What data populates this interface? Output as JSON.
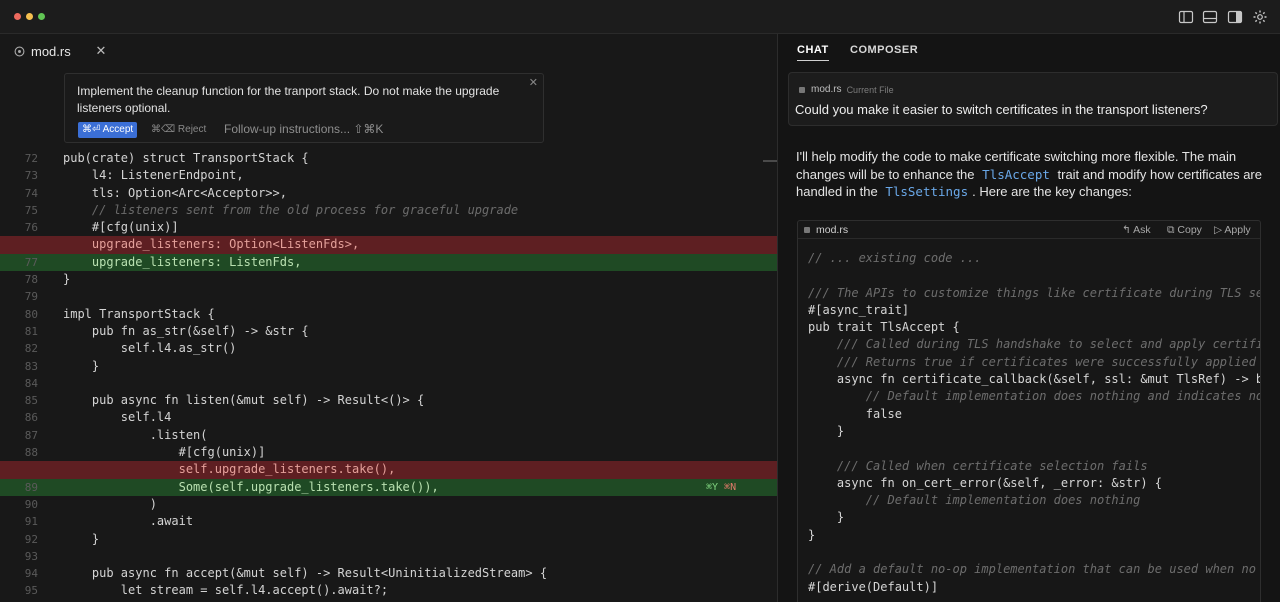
{
  "window": {
    "colors": {
      "close": "#ed6a5e",
      "minimize": "#f5bf4f",
      "maximize": "#61c554",
      "accept": "#3b6fd6"
    },
    "toolbar_icons": [
      "sidebar-left-icon",
      "panel-bottom-icon",
      "sidebar-right-icon",
      "gear-icon"
    ]
  },
  "editor": {
    "tab": {
      "label": "mod.rs",
      "close": "✕"
    },
    "prompt": {
      "text": "Implement the cleanup function for the tranport stack. Do not make the upgrade listeners optional.",
      "close": "✕",
      "accept": "⌘⏎ Accept",
      "reject": "⌘⌫ Reject",
      "followup": "Follow-up instructions... ⇧⌘K"
    },
    "lines": [
      {
        "n": "72",
        "t": "pub(crate) struct TransportStack {",
        "s": ""
      },
      {
        "n": "73",
        "t": "    l4: ListenerEndpoint,",
        "s": ""
      },
      {
        "n": "74",
        "t": "    tls: Option<Arc<Acceptor>>,",
        "s": ""
      },
      {
        "n": "75",
        "t": "    // listeners sent from the old process for graceful upgrade",
        "s": "c"
      },
      {
        "n": "76",
        "t": "    #[cfg(unix)]",
        "s": ""
      },
      {
        "n": "",
        "t": "    upgrade_listeners: Option<ListenFds>,",
        "s": "del"
      },
      {
        "n": "77",
        "t": "    upgrade_listeners: ListenFds,",
        "s": "add"
      },
      {
        "n": "78",
        "t": "}",
        "s": ""
      },
      {
        "n": "79",
        "t": "",
        "s": ""
      },
      {
        "n": "80",
        "t": "impl TransportStack {",
        "s": ""
      },
      {
        "n": "81",
        "t": "    pub fn as_str(&self) -> &str {",
        "s": ""
      },
      {
        "n": "82",
        "t": "        self.l4.as_str()",
        "s": ""
      },
      {
        "n": "83",
        "t": "    }",
        "s": ""
      },
      {
        "n": "84",
        "t": "",
        "s": ""
      },
      {
        "n": "85",
        "t": "    pub async fn listen(&mut self) -> Result<()> {",
        "s": ""
      },
      {
        "n": "86",
        "t": "        self.l4",
        "s": ""
      },
      {
        "n": "87",
        "t": "            .listen(",
        "s": ""
      },
      {
        "n": "88",
        "t": "                #[cfg(unix)]",
        "s": ""
      },
      {
        "n": "",
        "t": "                self.upgrade_listeners.take(),",
        "s": "del"
      },
      {
        "n": "89",
        "t": "                Some(self.upgrade_listeners.take()),",
        "s": "add"
      },
      {
        "n": "90",
        "t": "            )",
        "s": ""
      },
      {
        "n": "91",
        "t": "            .await",
        "s": ""
      },
      {
        "n": "92",
        "t": "    }",
        "s": ""
      },
      {
        "n": "93",
        "t": "",
        "s": ""
      },
      {
        "n": "94",
        "t": "    pub async fn accept(&mut self) -> Result<UninitializedStream> {",
        "s": ""
      },
      {
        "n": "95",
        "t": "        let stream = self.l4.accept().await?;",
        "s": ""
      }
    ],
    "diff_hints": {
      "yes": "⌘Y",
      "no": "⌘N"
    }
  },
  "chat": {
    "tabs": [
      "CHAT",
      "COMPOSER"
    ],
    "user_message": {
      "file": "mod.rs",
      "file_sub": "Current File",
      "text": "Could you make it easier to switch certificates in the transport listeners?"
    },
    "reply": {
      "p1": "I'll help modify the code to make certificate switching more flexible. The main changes will be to enhance the",
      "code1": "TlsAccept",
      "p2": "trait and modify how certificates are handled in the",
      "code2": "TlsSettings",
      "p3": ". Here are the key changes:"
    },
    "codeblock": {
      "file": "mod.rs",
      "actions": [
        "↰ Ask",
        "⧉ Copy",
        "▷ Apply"
      ],
      "lines": [
        {
          "t": "// ... existing code ...",
          "s": "c"
        },
        {
          "t": "",
          "s": ""
        },
        {
          "t": "/// The APIs to customize things like certificate during TLS ser",
          "s": "c"
        },
        {
          "t": "#[async_trait]",
          "s": ""
        },
        {
          "t": "pub trait TlsAccept {",
          "s": ""
        },
        {
          "t": "    /// Called during TLS handshake to select and apply certific",
          "s": "c"
        },
        {
          "t": "    /// Returns true if certificates were successfully applied",
          "s": "c"
        },
        {
          "t": "    async fn certificate_callback(&self, ssl: &mut TlsRef) -> bo",
          "s": ""
        },
        {
          "t": "        // Default implementation does nothing and indicates no",
          "s": "c"
        },
        {
          "t": "        false",
          "s": ""
        },
        {
          "t": "    }",
          "s": ""
        },
        {
          "t": "",
          "s": ""
        },
        {
          "t": "    /// Called when certificate selection fails",
          "s": "c"
        },
        {
          "t": "    async fn on_cert_error(&self, _error: &str) {",
          "s": ""
        },
        {
          "t": "        // Default implementation does nothing",
          "s": "c"
        },
        {
          "t": "    }",
          "s": ""
        },
        {
          "t": "}",
          "s": ""
        },
        {
          "t": "",
          "s": ""
        },
        {
          "t": "// Add a default no-op implementation that can be used when no c",
          "s": "c"
        },
        {
          "t": "#[derive(Default)]",
          "s": ""
        }
      ]
    }
  }
}
